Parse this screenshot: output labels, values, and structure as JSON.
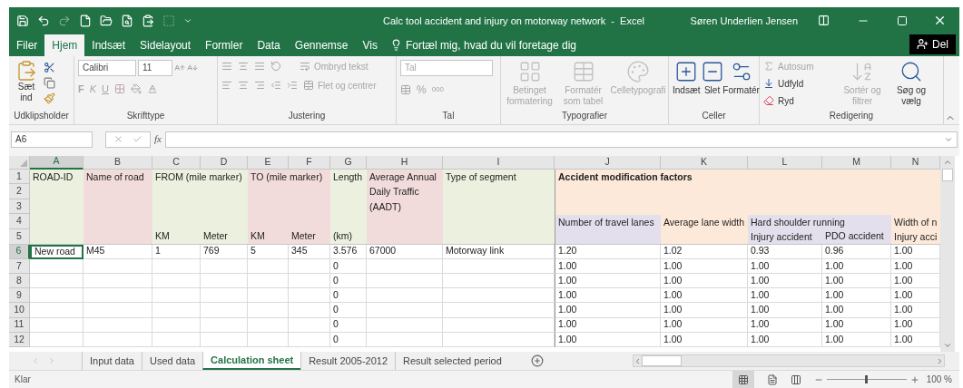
{
  "window": {
    "title": "Calc tool accident and injury on motorway network  -  Excel",
    "user": "Søren Underlien Jensen"
  },
  "ribbon_tabs": [
    {
      "label": "Filer",
      "selected": false
    },
    {
      "label": "Hjem",
      "selected": true
    },
    {
      "label": "Indsæt",
      "selected": false
    },
    {
      "label": "Sidelayout",
      "selected": false
    },
    {
      "label": "Formler",
      "selected": false
    },
    {
      "label": "Data",
      "selected": false
    },
    {
      "label": "Gennemse",
      "selected": false
    },
    {
      "label": "Vis",
      "selected": false
    }
  ],
  "tell_me": "Fortæl mig, hvad du vil foretage dig",
  "share": "Del",
  "ribbon": {
    "clipboard": {
      "label": "Udklipsholder",
      "paste": {
        "label": "Sæt ind",
        "disabled": false
      }
    },
    "font": {
      "label": "Skrifttype",
      "font_name": "Calibri",
      "font_size": "11",
      "styles": [
        {
          "label": "F",
          "disabled": true
        },
        {
          "label": "K",
          "disabled": true
        },
        {
          "label": "U",
          "disabled": true
        }
      ]
    },
    "alignment": {
      "label": "Justering",
      "wrap_text": {
        "label": "Ombryd tekst",
        "disabled": true
      },
      "merge": {
        "label": "Flet og centrer",
        "disabled": true
      }
    },
    "number": {
      "label": "Tal",
      "format": "Tal",
      "symbols": [
        {
          "label": "%",
          "disabled": true
        },
        {
          "label": "000",
          "disabled": true
        }
      ]
    },
    "styles": {
      "label": "Typografier",
      "buttons": [
        {
          "label": "Betinget formatering",
          "disabled": true
        },
        {
          "label": "Formatér som tabel",
          "disabled": true
        },
        {
          "label": "Celletypografi",
          "disabled": true
        }
      ]
    },
    "cells": {
      "label": "Celler",
      "buttons": [
        {
          "label": "Indsæt",
          "disabled": false
        },
        {
          "label": "Slet",
          "disabled": false
        },
        {
          "label": "Formatér",
          "disabled": false
        }
      ]
    },
    "editing": {
      "label": "Redigering",
      "small_buttons": [
        {
          "label": "Autosum",
          "disabled": true
        },
        {
          "label": "Udfyld",
          "disabled": false
        },
        {
          "label": "Ryd",
          "disabled": false
        }
      ],
      "large_buttons": [
        {
          "label": "Sortér og filtrer",
          "disabled": true
        },
        {
          "label": "Søg og vælg",
          "disabled": false
        }
      ]
    }
  },
  "formula_bar": {
    "name_box": "A6",
    "function_symbol": "fx"
  },
  "grid": {
    "columns": [
      {
        "letter": "A",
        "selected": true,
        "color": "#ebf1de",
        "title": "ROAD-ID",
        "bold": false,
        "wrap": false
      },
      {
        "letter": "B",
        "selected": false,
        "color": "#f2dcdb",
        "title": "Name of road",
        "bold": false,
        "wrap": false
      },
      {
        "letter": "C",
        "selected": false,
        "color": "#ebf1de",
        "title": "FROM (mile marker)",
        "unit": "KM",
        "bold": false,
        "wrap": false
      },
      {
        "letter": "D",
        "selected": false,
        "color": "#ebf1de",
        "unit": "Meter"
      },
      {
        "letter": "E",
        "selected": false,
        "color": "#f2dcdb",
        "title": "TO (mile marker)",
        "unit": "KM",
        "bold": false,
        "wrap": false
      },
      {
        "letter": "F",
        "selected": false,
        "color": "#f2dcdb",
        "unit": "Meter"
      },
      {
        "letter": "G",
        "selected": false,
        "color": "#ebf1de",
        "title": "Length",
        "unit": "(km)",
        "bold": false,
        "wrap": false
      },
      {
        "letter": "H",
        "selected": false,
        "color": "#f2dcdb",
        "title": "Average Annual Daily Traffic (AADT)",
        "bold": false,
        "wrap": true
      },
      {
        "letter": "I",
        "selected": false,
        "color": "#ebf1de",
        "title": "Type of segment",
        "bold": false,
        "wrap": false
      },
      {
        "letter": "J",
        "selected": false,
        "color": "#fde9d9",
        "lower": {
          "color": "#e4dfec"
        },
        "title": "Accident modification factors",
        "subtitle": "Number of travel lanes",
        "bold": true,
        "wrap": false
      },
      {
        "letter": "K",
        "selected": false,
        "color": "#fde9d9",
        "subtitle": "Average lane width"
      },
      {
        "letter": "L",
        "selected": false,
        "color": "#fde9d9",
        "lower": {
          "color": "#e4dfec"
        },
        "subtitle": "Hard shoulder running",
        "unit": "Injury accident"
      },
      {
        "letter": "M",
        "selected": false,
        "color": "#fde9d9",
        "lower": {
          "color": "#e4dfec"
        },
        "unit": "PDO accident"
      },
      {
        "letter": "N",
        "selected": false,
        "color": "#fde9d9",
        "subtitle": "Width of n",
        "unit": "Injury acci"
      }
    ],
    "header_rows": [
      "1",
      "2",
      "3",
      "4",
      "5"
    ],
    "rows": [
      {
        "number": "6",
        "selected": true,
        "cells": [
          "New road",
          "M45",
          "1",
          "769",
          "5",
          "345",
          "3.576",
          "67000",
          "Motorway link",
          "1.20",
          "1.02",
          "0.93",
          "0.96",
          "1.00"
        ]
      },
      {
        "number": "7",
        "selected": false,
        "cells": [
          null,
          null,
          null,
          null,
          null,
          null,
          "0",
          null,
          null,
          "1.00",
          "1.00",
          "1.00",
          "1.00",
          "1.00"
        ]
      },
      {
        "number": "8",
        "selected": false,
        "cells": [
          null,
          null,
          null,
          null,
          null,
          null,
          "0",
          null,
          null,
          "1.00",
          "1.00",
          "1.00",
          "1.00",
          "1.00"
        ]
      },
      {
        "number": "9",
        "selected": false,
        "cells": [
          null,
          null,
          null,
          null,
          null,
          null,
          "0",
          null,
          null,
          "1.00",
          "1.00",
          "1.00",
          "1.00",
          "1.00"
        ]
      },
      {
        "number": "10",
        "selected": false,
        "cells": [
          null,
          null,
          null,
          null,
          null,
          null,
          "0",
          null,
          null,
          "1.00",
          "1.00",
          "1.00",
          "1.00",
          "1.00"
        ]
      },
      {
        "number": "11",
        "selected": false,
        "cells": [
          null,
          null,
          null,
          null,
          null,
          null,
          "0",
          null,
          null,
          "1.00",
          "1.00",
          "1.00",
          "1.00",
          "1.00"
        ]
      },
      {
        "number": "12",
        "selected": false,
        "cells": [
          null,
          null,
          null,
          null,
          null,
          null,
          "0",
          null,
          null,
          "1.00",
          "1.00",
          "1.00",
          "1.00",
          "1.00"
        ]
      }
    ]
  },
  "sheet_tabs": [
    {
      "label": "Input data",
      "selected": false
    },
    {
      "label": "Used data",
      "selected": false
    },
    {
      "label": "Calculation sheet",
      "selected": true
    },
    {
      "label": "Result 2005-2012",
      "selected": false
    },
    {
      "label": "Result selected period",
      "selected": false
    }
  ],
  "status_bar": {
    "status": "Klar",
    "zoom": "100 %",
    "zoom_slider": {
      "level": 0.5
    }
  }
}
